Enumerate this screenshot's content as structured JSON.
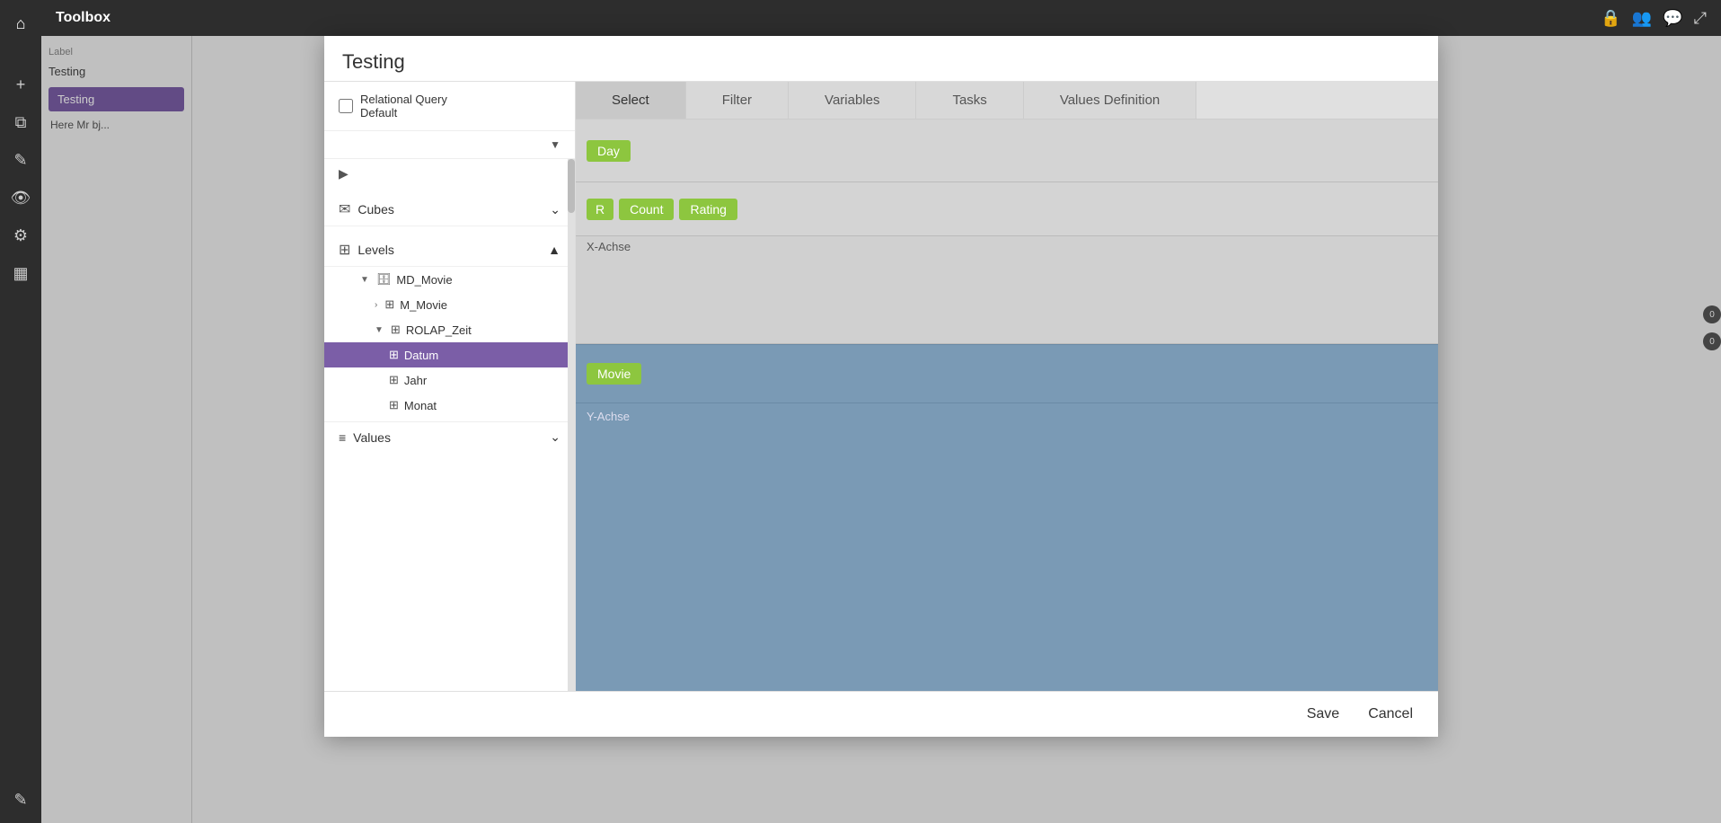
{
  "app": {
    "title": "Toolbox",
    "dialog_title": "Testing"
  },
  "sidebar": {
    "icons": [
      "⌂",
      "✚",
      "📄",
      "✏",
      "👁",
      "⚙",
      "📊",
      "✎"
    ]
  },
  "left_panel": {
    "label_text": "Label",
    "label_value": "Testing",
    "item_label": "Testing",
    "item_text": "Here Mr bj..."
  },
  "dialog": {
    "title": "Testing",
    "checkbox_label": "Relational Query Default",
    "checkbox_checked": false,
    "dropdown_label": "",
    "sections": {
      "cubes": {
        "label": "Cubes",
        "expanded": true,
        "items": []
      },
      "levels": {
        "label": "Levels",
        "expanded": true,
        "items": [
          {
            "label": "MD_Movie",
            "expanded": true,
            "children": [
              {
                "label": "M_Movie",
                "expanded": false,
                "children": []
              },
              {
                "label": "ROLAP_Zeit",
                "expanded": true,
                "children": [
                  {
                    "label": "Datum",
                    "active": true
                  },
                  {
                    "label": "Jahr",
                    "active": false
                  },
                  {
                    "label": "Monat",
                    "active": false
                  }
                ]
              }
            ]
          }
        ]
      },
      "values": {
        "label": "Values",
        "expanded": false
      }
    },
    "tabs": [
      {
        "label": "Select",
        "active": true
      },
      {
        "label": "Filter",
        "active": false
      },
      {
        "label": "Variables",
        "active": false
      },
      {
        "label": "Tasks",
        "active": false
      },
      {
        "label": "Values Definition",
        "active": false
      }
    ],
    "drop_zones": {
      "top_chips": [
        "Day"
      ],
      "middle_chips": [
        "R",
        "Count",
        "Rating"
      ],
      "x_achse_label": "X-Achse",
      "movie_chip": "Movie",
      "y_achse_label": "Y-Achse"
    },
    "footer": {
      "save_label": "Save",
      "cancel_label": "Cancel"
    }
  },
  "icons": {
    "home": "⌂",
    "plus": "+",
    "copy": "⧉",
    "edit": "✎",
    "eye": "◉",
    "gear": "⚙",
    "chart": "▦",
    "pen": "✎",
    "lock": "🔒",
    "users": "👥",
    "chat": "💬",
    "expand": "⤢",
    "arrow_right": "▶",
    "arrow_down": "▼",
    "chevron_right": "›",
    "chevron_down": "⌄",
    "cube_icon": "⬡",
    "level_icon": "⊞",
    "db_icon": "🗄",
    "badge_0": "0"
  }
}
